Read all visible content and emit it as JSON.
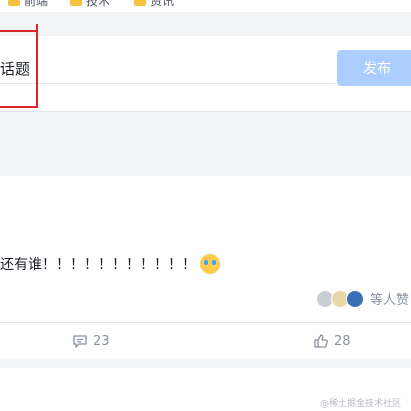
{
  "bookmarks": [
    {
      "label": "前端"
    },
    {
      "label": "技术"
    },
    {
      "label": "资讯"
    }
  ],
  "composer": {
    "topic_text": "话题",
    "publish_label": "发布"
  },
  "post": {
    "text": "还有谁！！！！！！！！！！！",
    "emoji": "crying-face-icon",
    "likers_text": "等人赞",
    "comment_count": "23",
    "like_count": "28"
  },
  "watermark": "@稀土掘金技术社区",
  "colors": {
    "accent_button": "#abcdff",
    "highlight_box": "#d8262b",
    "muted_text": "#8a919f"
  }
}
